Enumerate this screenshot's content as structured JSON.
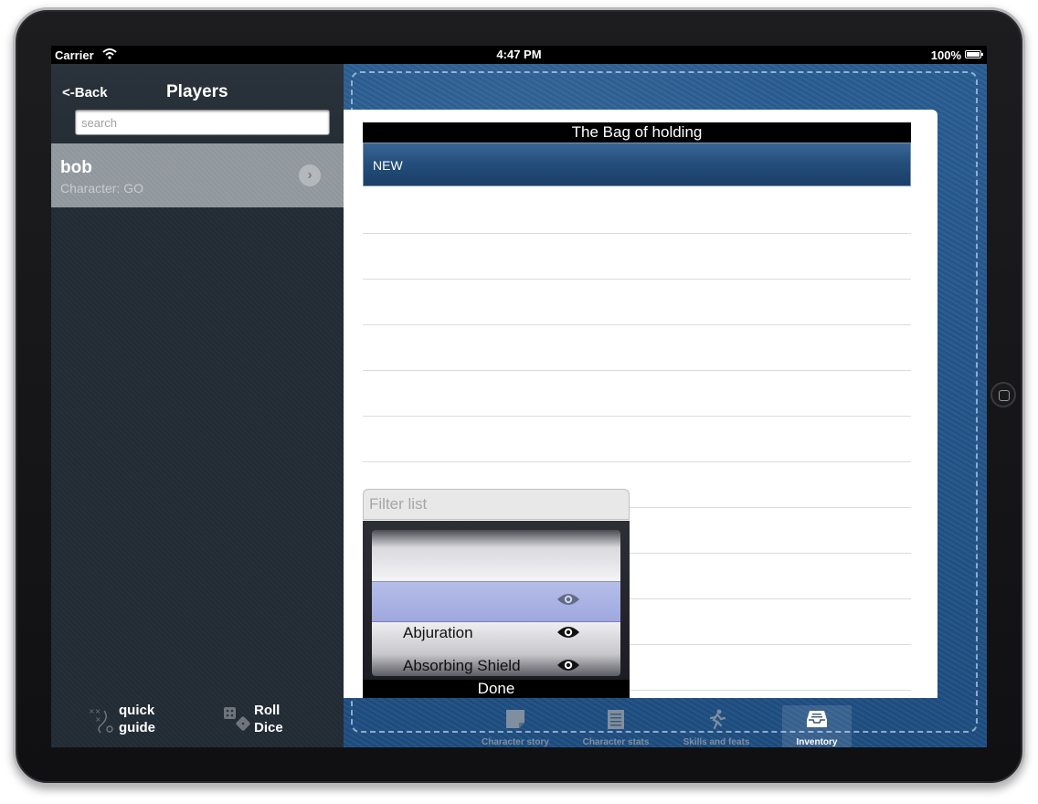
{
  "status_bar": {
    "carrier": "Carrier",
    "time": "4:47 PM",
    "battery": "100%"
  },
  "sidebar": {
    "back_label": "<-Back",
    "title": "Players",
    "search_placeholder": "search",
    "players": [
      {
        "name": "bob",
        "subtitle": "Character: GO"
      }
    ],
    "tools": {
      "quick_guide": "quick\nguide",
      "roll_dice": "Roll\nDice"
    }
  },
  "inventory": {
    "title": "The Bag of holding",
    "new_label": "NEW"
  },
  "filter": {
    "placeholder": "Filter list",
    "picker_items": [
      {
        "label": ""
      },
      {
        "label": "Abjuration"
      },
      {
        "label": "Absorbing Shield"
      }
    ],
    "done_label": "Done"
  },
  "tab_bar": {
    "tabs": [
      {
        "label": "Character story",
        "icon": "note-icon",
        "active": false
      },
      {
        "label": "Character stats",
        "icon": "notepad-icon",
        "active": false
      },
      {
        "label": "Skills and feats",
        "icon": "running-person-icon",
        "active": false
      },
      {
        "label": "Inventory",
        "icon": "inbox-tray-icon",
        "active": true
      }
    ]
  },
  "colors": {
    "accent": "#1f4f83",
    "sidebar_bg": "#222a32",
    "selected_row": "#8f969c"
  }
}
